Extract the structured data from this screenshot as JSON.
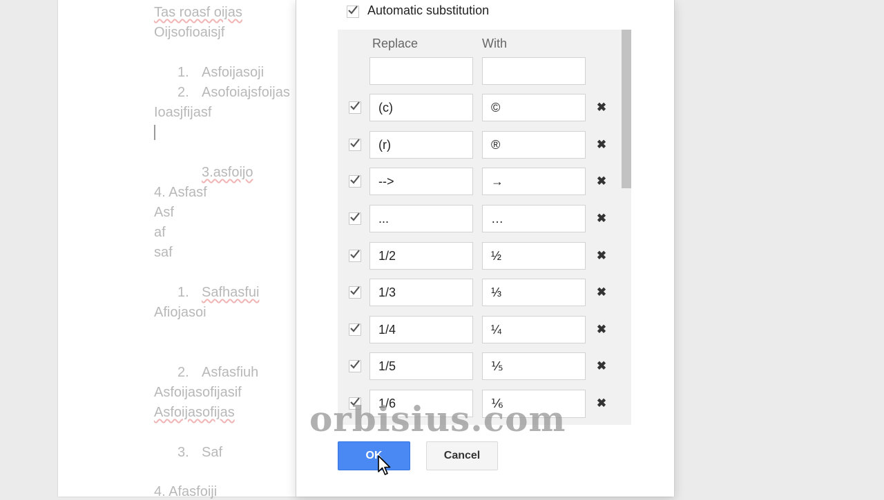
{
  "document": {
    "lines": [
      {
        "text": "Tas roasf oijas",
        "num": ""
      },
      {
        "text": "Oijsofioaisjf",
        "num": ""
      },
      {
        "text": "Asfoijasoji",
        "num": "1."
      },
      {
        "text": "Asofoiajsfoijas",
        "num": "2."
      },
      {
        "text": "Ioasjfijasf",
        "num": ""
      },
      {
        "text": "3.asfoijo",
        "num": ""
      },
      {
        "text": "4. Asfasf",
        "num": ""
      },
      {
        "text": "Asf",
        "num": ""
      },
      {
        "text": "af",
        "num": ""
      },
      {
        "text": "saf",
        "num": ""
      },
      {
        "text": "Safhasfui",
        "num": "1."
      },
      {
        "text": "Afiojasoi",
        "num": ""
      },
      {
        "text": "Asfasfiuh",
        "num": "2."
      },
      {
        "text": "Asfoijasofijasif",
        "num": ""
      },
      {
        "text": "Asfoijasofijas",
        "num": ""
      },
      {
        "text": "Saf",
        "num": "3."
      },
      {
        "text": "4. Afasfoiji",
        "num": ""
      }
    ]
  },
  "dialog": {
    "auto_substitution_label": "Automatic substitution",
    "auto_substitution_checked": true,
    "columns": {
      "replace": "Replace",
      "with": "With"
    },
    "new_entry": {
      "replace": "",
      "with": ""
    },
    "rows": [
      {
        "replace": "(c)",
        "with": "©",
        "checked": true
      },
      {
        "replace": "(r)",
        "with": "®",
        "checked": true
      },
      {
        "replace": "-->",
        "with": "→",
        "checked": true
      },
      {
        "replace": "...",
        "with": "…",
        "checked": true
      },
      {
        "replace": "1/2",
        "with": "½",
        "checked": true
      },
      {
        "replace": "1/3",
        "with": "⅓",
        "checked": true
      },
      {
        "replace": "1/4",
        "with": "¼",
        "checked": true
      },
      {
        "replace": "1/5",
        "with": "⅕",
        "checked": true
      },
      {
        "replace": "1/6",
        "with": "⅙",
        "checked": true
      }
    ],
    "delete_icon": "close-icon",
    "ok_label": "OK",
    "cancel_label": "Cancel"
  },
  "watermark": "orbisius.com",
  "colors": {
    "ok_button": "#4a89f3",
    "dialog_bg": "#ffffff",
    "table_bg": "#f1f1f1"
  }
}
